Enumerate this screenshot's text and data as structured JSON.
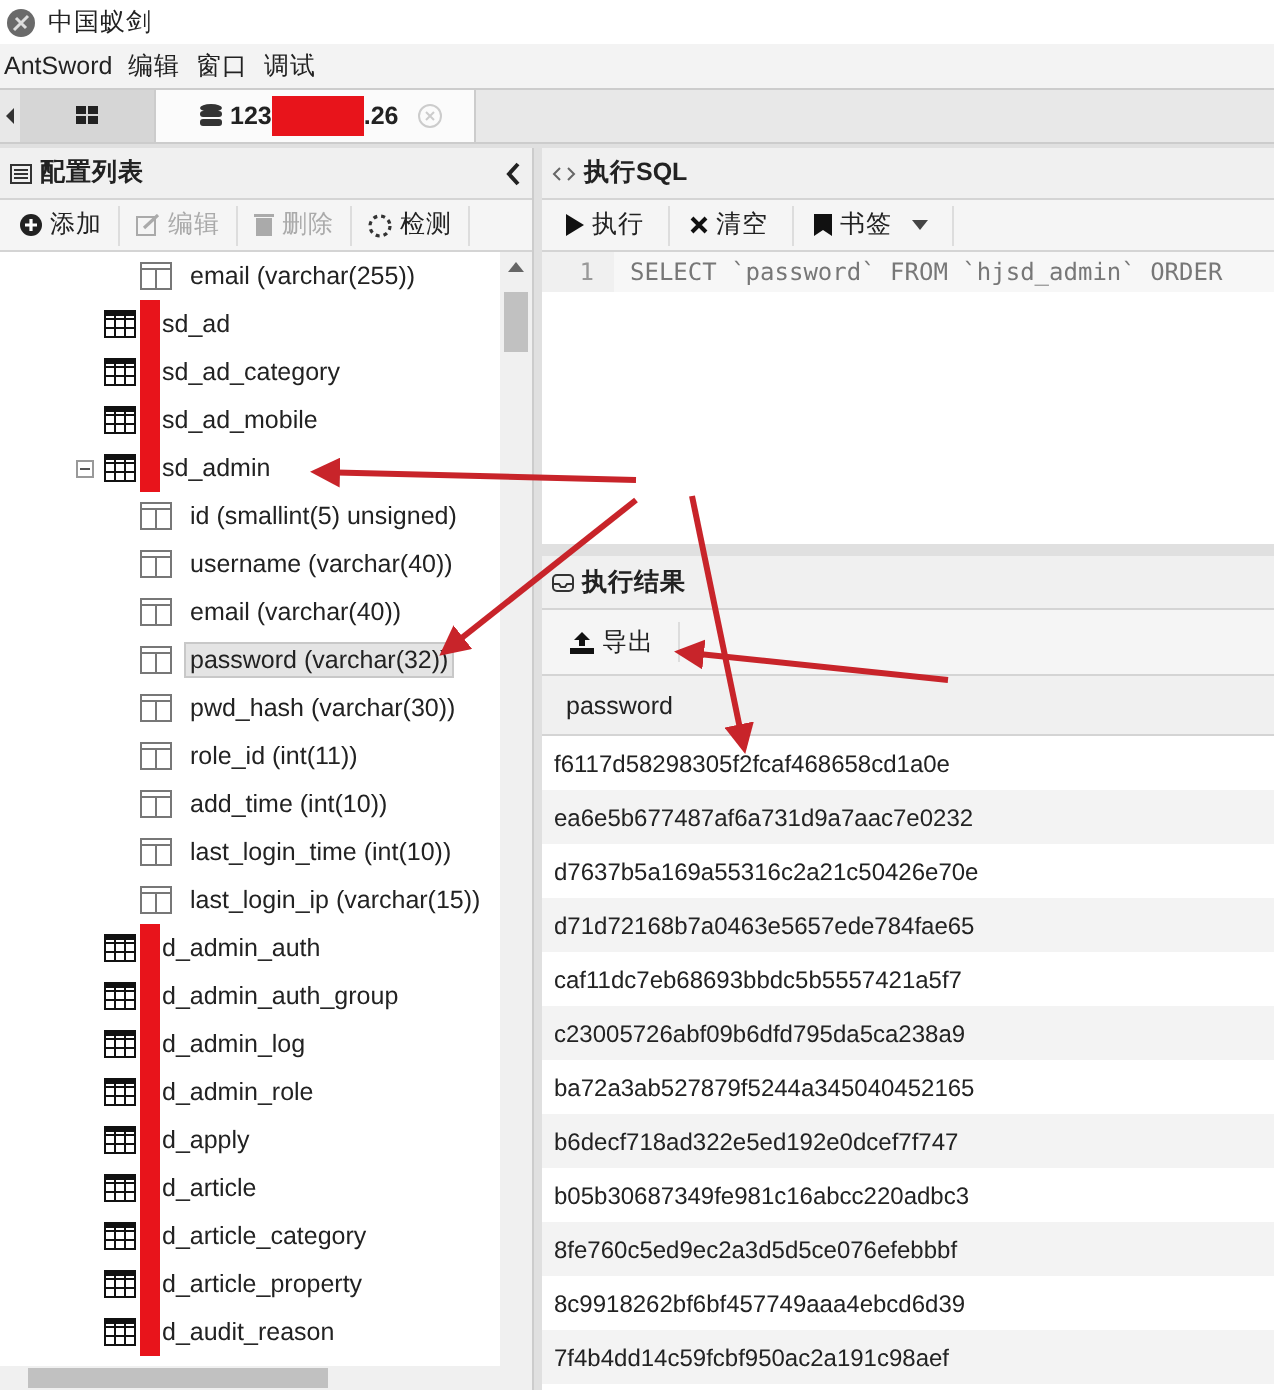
{
  "window": {
    "title": "中国蚁剑"
  },
  "menu": [
    "AntSword",
    "编辑",
    "窗口",
    "调试"
  ],
  "tabs": [
    {
      "kind": "home",
      "selected": false
    },
    {
      "kind": "connection",
      "label_start": "123",
      "label_end": ".26",
      "redacted": true,
      "selected": true
    }
  ],
  "sidebar": {
    "title": "配置列表",
    "toolbar": [
      {
        "kind": "add",
        "label": "添加",
        "disabled": false
      },
      {
        "kind": "edit",
        "label": "编辑",
        "disabled": true
      },
      {
        "kind": "delete",
        "label": "删除",
        "disabled": true
      },
      {
        "kind": "check",
        "label": "检测",
        "disabled": false
      }
    ],
    "tree": [
      {
        "kind": "column",
        "label": "email (varchar(255))",
        "selected": false
      },
      {
        "kind": "table",
        "label": "sd_ad",
        "redacted": true,
        "expanded": false
      },
      {
        "kind": "table",
        "label": "sd_ad_category",
        "redacted": true,
        "expanded": false
      },
      {
        "kind": "table",
        "label": "sd_ad_mobile",
        "redacted": true,
        "expanded": false
      },
      {
        "kind": "table",
        "label": "sd_admin",
        "redacted": true,
        "expanded": true,
        "children": [
          {
            "kind": "column",
            "label": "id (smallint(5) unsigned)",
            "selected": false
          },
          {
            "kind": "column",
            "label": "username (varchar(40))",
            "selected": false
          },
          {
            "kind": "column",
            "label": "email (varchar(40))",
            "selected": false
          },
          {
            "kind": "column",
            "label": "password (varchar(32))",
            "selected": true
          },
          {
            "kind": "column",
            "label": "pwd_hash (varchar(30))",
            "selected": false
          },
          {
            "kind": "column",
            "label": "role_id (int(11))",
            "selected": false
          },
          {
            "kind": "column",
            "label": "add_time (int(10))",
            "selected": false
          },
          {
            "kind": "column",
            "label": "last_login_time (int(10))",
            "selected": false
          },
          {
            "kind": "column",
            "label": "last_login_ip (varchar(15))",
            "selected": false
          }
        ]
      },
      {
        "kind": "table",
        "label": "d_admin_auth",
        "redacted": true,
        "expanded": false
      },
      {
        "kind": "table",
        "label": "d_admin_auth_group",
        "redacted": true,
        "expanded": false
      },
      {
        "kind": "table",
        "label": "d_admin_log",
        "redacted": true,
        "expanded": false
      },
      {
        "kind": "table",
        "label": "d_admin_role",
        "redacted": true,
        "expanded": false
      },
      {
        "kind": "table",
        "label": "d_apply",
        "redacted": true,
        "expanded": false
      },
      {
        "kind": "table",
        "label": "d_article",
        "redacted": true,
        "expanded": false
      },
      {
        "kind": "table",
        "label": "d_article_category",
        "redacted": true,
        "expanded": false
      },
      {
        "kind": "table",
        "label": "d_article_property",
        "redacted": true,
        "expanded": false
      },
      {
        "kind": "table",
        "label": "d_audit_reason",
        "redacted": true,
        "expanded": false
      }
    ]
  },
  "sql_panel": {
    "title": "执行SQL",
    "toolbar": [
      {
        "kind": "run",
        "label": "执行"
      },
      {
        "kind": "clear",
        "label": "清空"
      },
      {
        "kind": "bookmark",
        "label": "书签"
      }
    ],
    "editor": {
      "lines": [
        {
          "number": "1",
          "code": "SELECT `password` FROM `hjsd_admin` ORDER"
        }
      ]
    }
  },
  "result_panel": {
    "title": "执行结果",
    "toolbar": [
      {
        "kind": "export",
        "label": "导出"
      }
    ],
    "table": {
      "columns": [
        "password"
      ],
      "rows": [
        [
          "f6117d58298305f2fcaf468658cd1a0e"
        ],
        [
          "ea6e5b677487af6a731d9a7aac7e0232"
        ],
        [
          "d7637b5a169a55316c2a21c50426e70e"
        ],
        [
          "d71d72168b7a0463e5657ede784fae65"
        ],
        [
          "caf11dc7eb68693bbdc5b5557421a5f7"
        ],
        [
          "c23005726abf09b6dfd795da5ca238a9"
        ],
        [
          "ba72a3ab527879f5244a345040452165"
        ],
        [
          "b6decf718ad322e5ed192e0dcef7f747"
        ],
        [
          "b05b30687349fe981c16abcc220adbc3"
        ],
        [
          "8fe760c5ed9ec2a3d5d5ce076efebbbf"
        ],
        [
          "8c9918262bf6bf457749aaa4ebcd6d39"
        ],
        [
          "7f4b4dd14c59fcbf950ac2a191c98aef"
        ]
      ]
    }
  },
  "annotations": [
    {
      "kind": "arrow"
    },
    {
      "kind": "arrow"
    },
    {
      "kind": "arrow"
    },
    {
      "kind": "arrow"
    }
  ]
}
